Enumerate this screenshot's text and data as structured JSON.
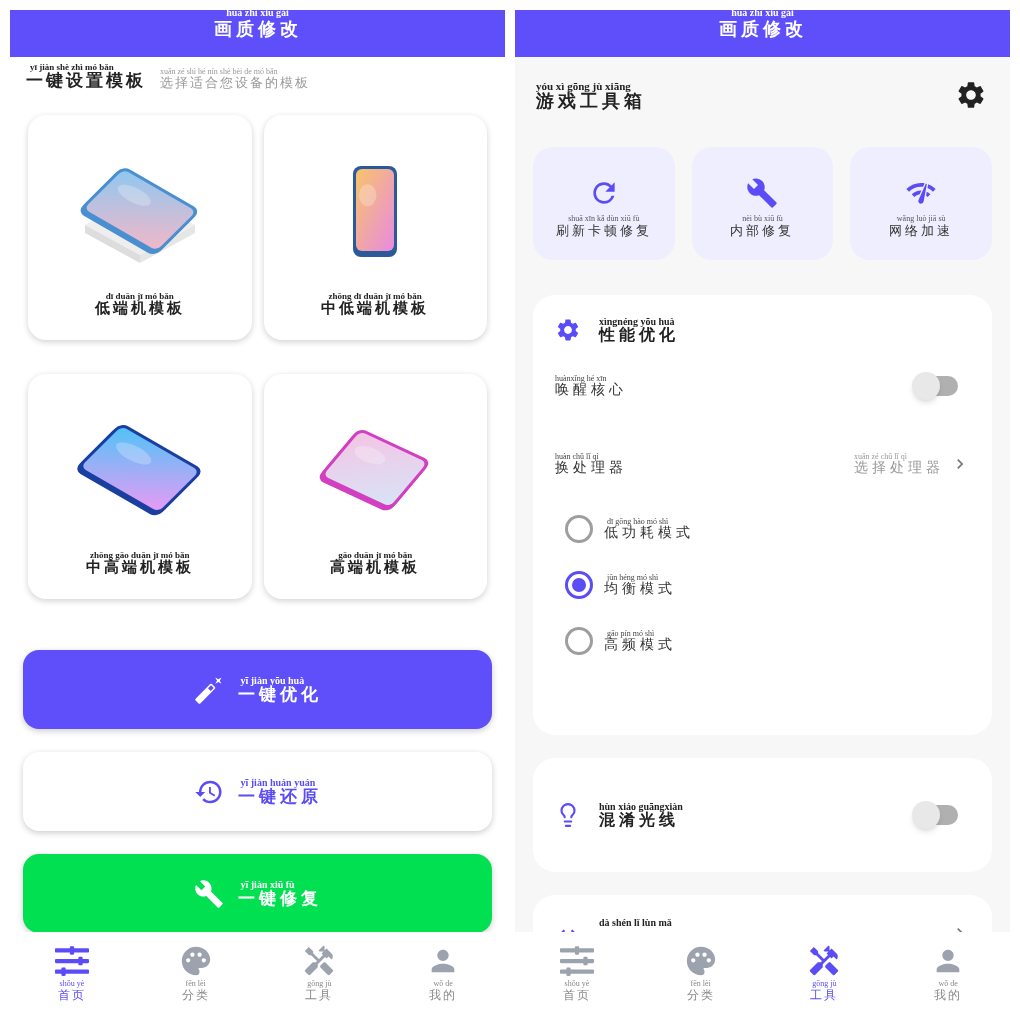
{
  "left_screen": {
    "header": {
      "pinyin": "huà zhì xiū gǎi",
      "title": "画质修改"
    },
    "section": {
      "pinyin": "yī jiàn shè zhì mó bǎn",
      "title": "一键设置模板",
      "hint_pinyin": "xuǎn zé shì hé nín shè bèi de mó bǎn",
      "hint": "选择适合您设备的模板"
    },
    "templates": [
      {
        "kind": "picture",
        "pinyin": "dī duān jī mó bǎn",
        "label": "低端机模板"
      },
      {
        "kind": "picture",
        "pinyin": "zhōng dī duān jī mó bǎn",
        "label": "中低端机模板"
      },
      {
        "kind": "picture",
        "pinyin": "zhōng gāo duān jī mó bǎn",
        "label": "中高端机模板"
      },
      {
        "kind": "picture",
        "pinyin": "gāo duān jī mó bǎn",
        "label": "高端机模板"
      }
    ],
    "actions": [
      {
        "kind": "primary",
        "pinyin": "yī jiàn yōu huà",
        "label": "一键优化"
      },
      {
        "kind": "outline",
        "pinyin": "yī jiàn huán yuán",
        "label": "一键还原"
      },
      {
        "kind": "success",
        "pinyin": "yī jiàn xiū fù",
        "label": "一键修复"
      }
    ],
    "nav": [
      {
        "pinyin": "shǒu yè",
        "label": "首页",
        "selected": true
      },
      {
        "pinyin": "fēn lèi",
        "label": "分类",
        "selected": false
      },
      {
        "pinyin": "gōng jù",
        "label": "工具",
        "selected": false
      },
      {
        "pinyin": "wǒ de",
        "label": "我的",
        "selected": false
      }
    ]
  },
  "right_screen": {
    "header": {
      "pinyin": "huà zhì xiū gǎi",
      "title": "画质修改"
    },
    "title": {
      "pinyin": "yóu xì gōng jù xiāng",
      "text": "游戏工具箱"
    },
    "tools": [
      {
        "pinyin": "shuā xīn kǎ dùn xiū fù",
        "label": "刷新卡顿修复"
      },
      {
        "pinyin": "nèi bù xiū fù",
        "label": "内部修复"
      },
      {
        "pinyin": "wǎng luò jiā sù",
        "label": "网络加速"
      }
    ],
    "performance": {
      "pinyin": "xìngnéng yōu huà",
      "title": "性能优化",
      "rows": [
        {
          "kind": "toggle",
          "pinyin": "huànxǐng hé xīn",
          "label": "唤醒核心",
          "on": false
        },
        {
          "kind": "select",
          "pinyin": "huàn chǔ lǐ qì",
          "label": "换处理器",
          "value_pinyin": "xuǎn zé chǔ lǐ qì",
          "value": "选择处理器"
        }
      ],
      "modes": [
        {
          "pinyin": "dī gōng hào mó shì",
          "label": "低功耗模式",
          "selected": false
        },
        {
          "pinyin": "jūn héng mó shì",
          "label": "均衡模式",
          "selected": true
        },
        {
          "pinyin": "gāo pín mó shì",
          "label": "高频模式",
          "selected": false
        }
      ]
    },
    "light": {
      "pinyin": "hùn xiáo guāngxiàn",
      "label": "混淆光线",
      "on": false
    },
    "partial_card": {
      "pinyin": "dà shén lǐ lùn mǎ"
    },
    "nav": [
      {
        "pinyin": "shǒu yè",
        "label": "首页",
        "selected": false
      },
      {
        "pinyin": "fēn lèi",
        "label": "分类",
        "selected": false
      },
      {
        "pinyin": "gōng jù",
        "label": "工具",
        "selected": true
      },
      {
        "pinyin": "wǒ de",
        "label": "我的",
        "selected": false
      }
    ]
  }
}
